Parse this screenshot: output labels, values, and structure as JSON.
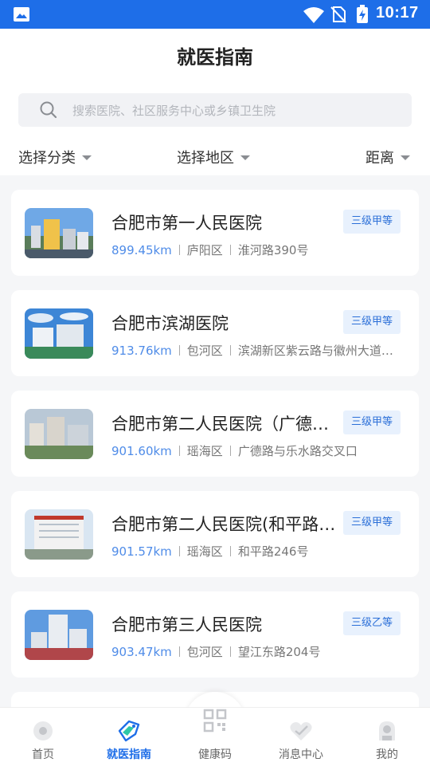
{
  "status_bar": {
    "time": "10:17"
  },
  "header": {
    "title": "就医指南"
  },
  "search": {
    "placeholder": "搜索医院、社区服务中心或乡镇卫生院"
  },
  "filters": {
    "category": "选择分类",
    "region": "选择地区",
    "distance": "距离"
  },
  "hospitals": [
    {
      "name": "合肥市第一人民医院",
      "level": "三级甲等",
      "distance": "899.45km",
      "district": "庐阳区",
      "address": "淮河路390号"
    },
    {
      "name": "合肥市滨湖医院",
      "level": "三级甲等",
      "distance": "913.76km",
      "district": "包河区",
      "address": "滨湖新区紫云路与徽州大道交口"
    },
    {
      "name": "合肥市第二人民医院（广德路院区）",
      "level": "三级甲等",
      "distance": "901.60km",
      "district": "瑶海区",
      "address": "广德路与乐水路交叉口"
    },
    {
      "name": "合肥市第二人民医院(和平路院区)",
      "level": "三级甲等",
      "distance": "901.57km",
      "district": "瑶海区",
      "address": "和平路246号"
    },
    {
      "name": "合肥市第三人民医院",
      "level": "三级乙等",
      "distance": "903.47km",
      "district": "包河区",
      "address": "望江东路204号"
    }
  ],
  "tabbar": {
    "items": [
      {
        "label": "首页",
        "icon": "home-icon"
      },
      {
        "label": "就医指南",
        "icon": "guide-tag-icon"
      },
      {
        "label": "健康码",
        "icon": "qr-code-icon"
      },
      {
        "label": "消息中心",
        "icon": "heart-message-icon"
      },
      {
        "label": "我的",
        "icon": "profile-icon"
      }
    ],
    "active_index": 1
  },
  "colors": {
    "primary": "#1e6ee8",
    "badge_bg": "#e8f1fd",
    "distance": "#4f8ce8"
  }
}
